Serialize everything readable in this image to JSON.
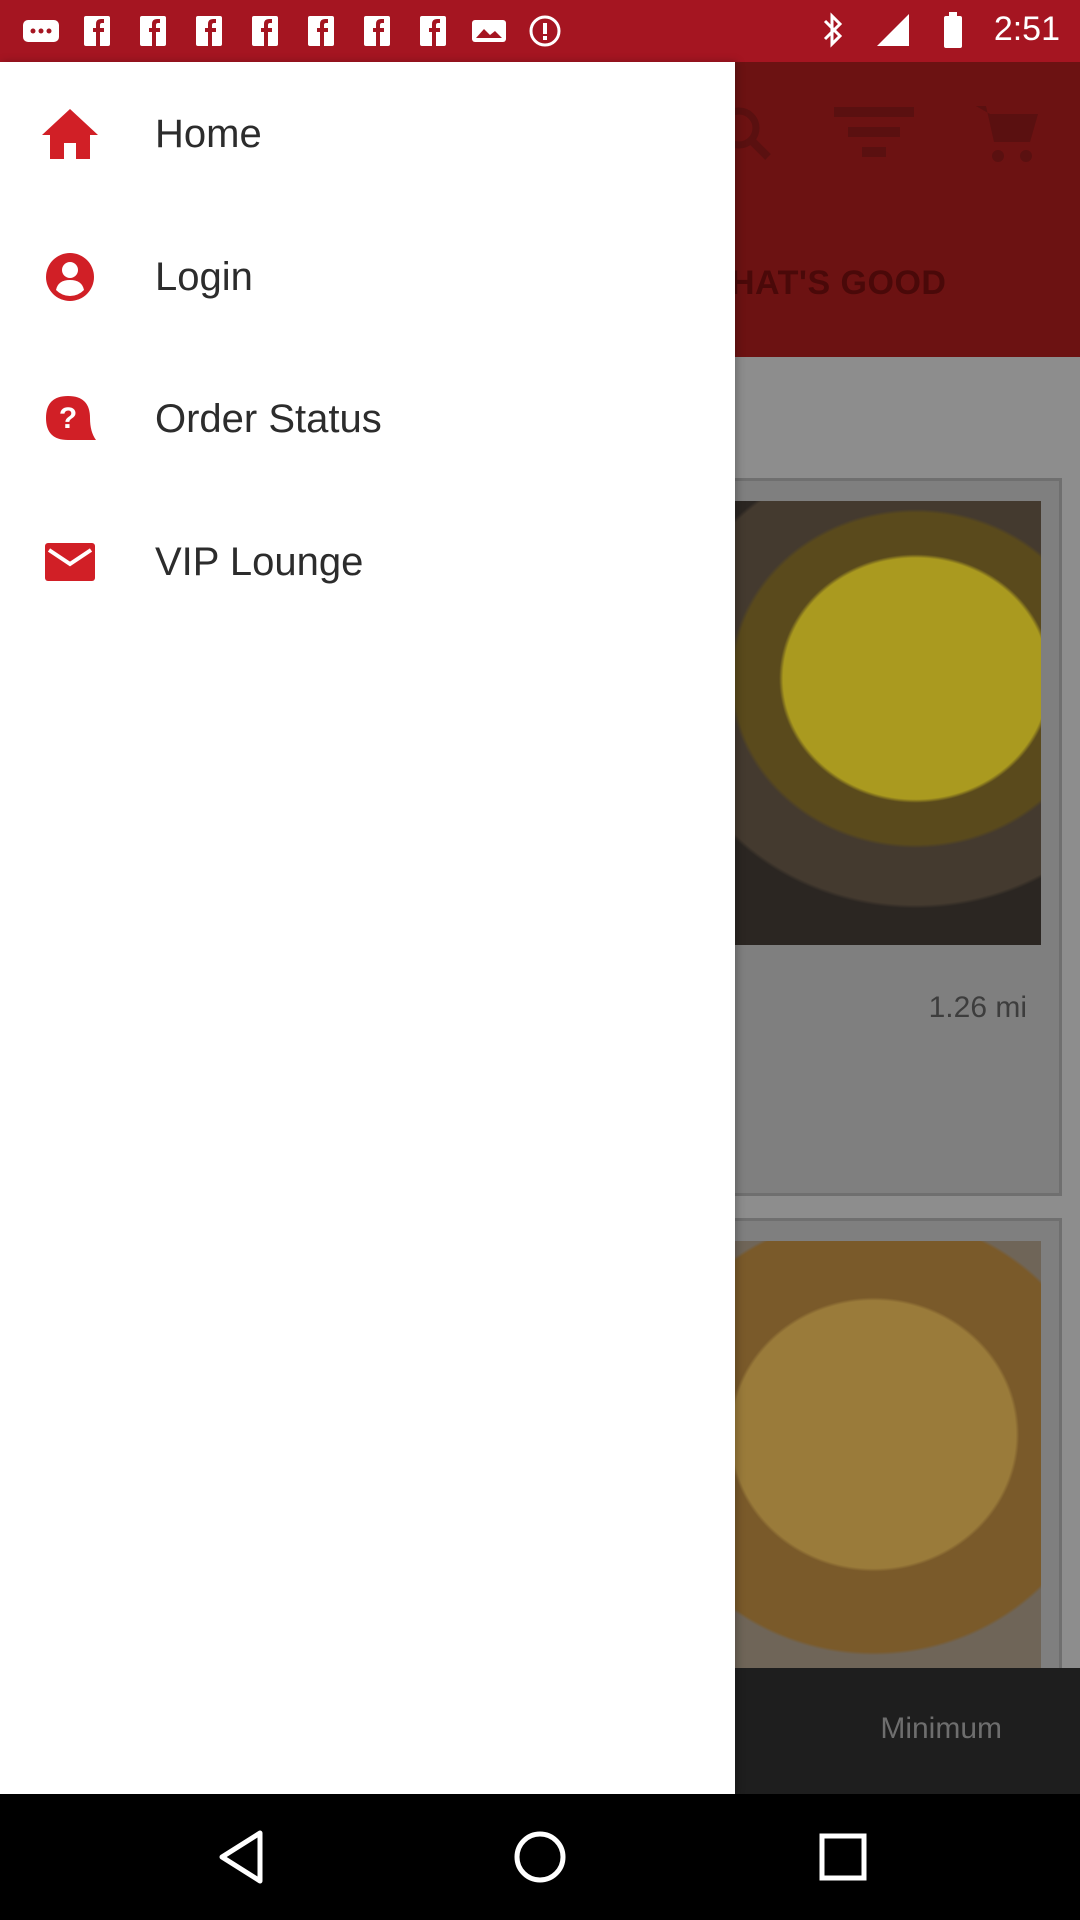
{
  "status_bar": {
    "time": "2:51",
    "left_icons": [
      "more-icon",
      "fb-icon",
      "fb-icon",
      "fb-icon",
      "fb-icon",
      "fb-icon",
      "fb-icon",
      "fb-icon",
      "pictures-icon",
      "alert-icon"
    ],
    "right_icons": [
      "bluetooth-icon",
      "signal-icon",
      "battery-icon"
    ]
  },
  "app": {
    "header_tab": "HAT'S GOOD",
    "card_distance": "1.26 mi",
    "footer_text": "Minimum"
  },
  "drawer": {
    "items": [
      {
        "label": "Home",
        "icon": "home-icon"
      },
      {
        "label": "Login",
        "icon": "account-icon"
      },
      {
        "label": "Order Status",
        "icon": "help-chat-icon"
      },
      {
        "label": "VIP Lounge",
        "icon": "mail-icon"
      }
    ]
  },
  "colors": {
    "accent": "#d11f26",
    "status_bar": "#a51521"
  }
}
